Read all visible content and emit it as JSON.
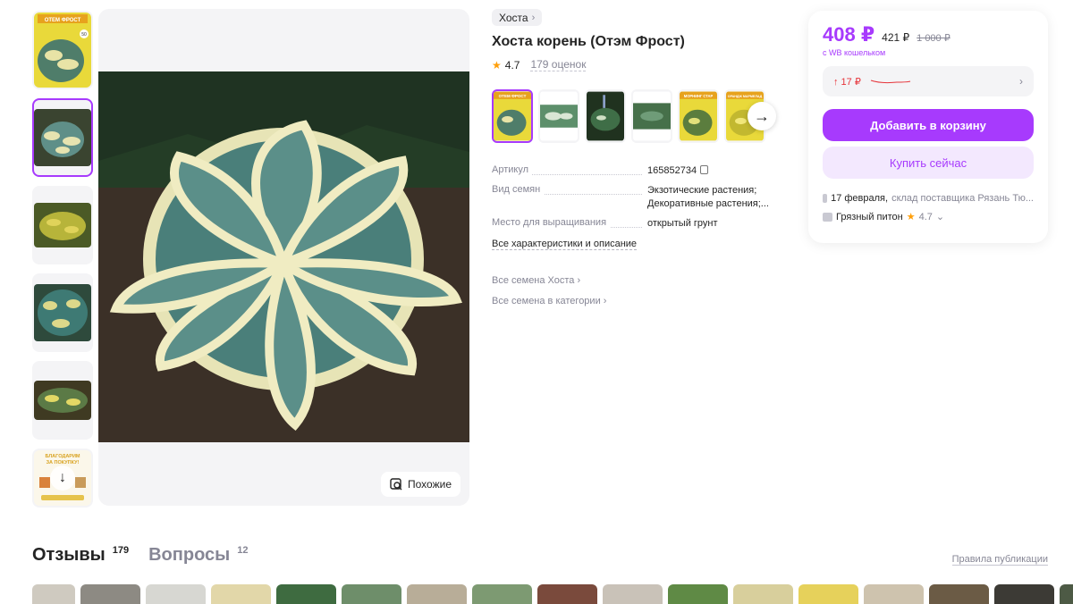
{
  "breadcrumb": {
    "brand": "Хоста"
  },
  "product": {
    "title": "Хоста корень (Отэм Фрост)",
    "rating": "4.7",
    "reviews_count": "179 оценок"
  },
  "gallery": {
    "thumb1_label": "ОТЕМ ФРОСТ",
    "thumb1_count": "50",
    "thumb6_line1": "БЛАГОДАРИМ",
    "thumb6_line2": "ЗА ПОКУПКУ!",
    "similar_label": "Похожие"
  },
  "variants": [
    {
      "label": "ОТЕМ ФРОСТ"
    },
    {
      "label": ""
    },
    {
      "label": ""
    },
    {
      "label": ""
    },
    {
      "label": "МОРНИНГ СТАР"
    },
    {
      "label": "ОРАНДЖ МАРМЕЛАД"
    }
  ],
  "specs": {
    "article_key": "Артикул",
    "article_val": "165852734",
    "seed_key": "Вид семян",
    "seed_val": "Экзотические растения; Декоративные растения;...",
    "place_key": "Место для выращивания",
    "place_val": "открытый грунт",
    "all_link": "Все характеристики и описание"
  },
  "links": {
    "all_seeds": "Все семена Хоста",
    "all_category": "Все семена в категории"
  },
  "price": {
    "main": "408 ₽",
    "alt": "421 ₽",
    "old": "1 000 ₽",
    "wallet_note": "с WB кошельком",
    "history": "↑ 17 ₽",
    "add_to_cart": "Добавить в корзину",
    "buy_now": "Купить сейчас",
    "delivery_date": "17 февраля,",
    "delivery_warehouse": "склад поставщика Рязань Тю...",
    "seller_name": "Грязный питон",
    "seller_rating": "4.7"
  },
  "tabs": {
    "reviews": "Отзывы",
    "reviews_count": "179",
    "questions": "Вопросы",
    "questions_count": "12",
    "rules": "Правила публикации"
  },
  "colors": {
    "accent": "#a73afd",
    "accent_light": "#f3e8fe",
    "price_up": "#e63339",
    "star": "#ff9f0a"
  }
}
